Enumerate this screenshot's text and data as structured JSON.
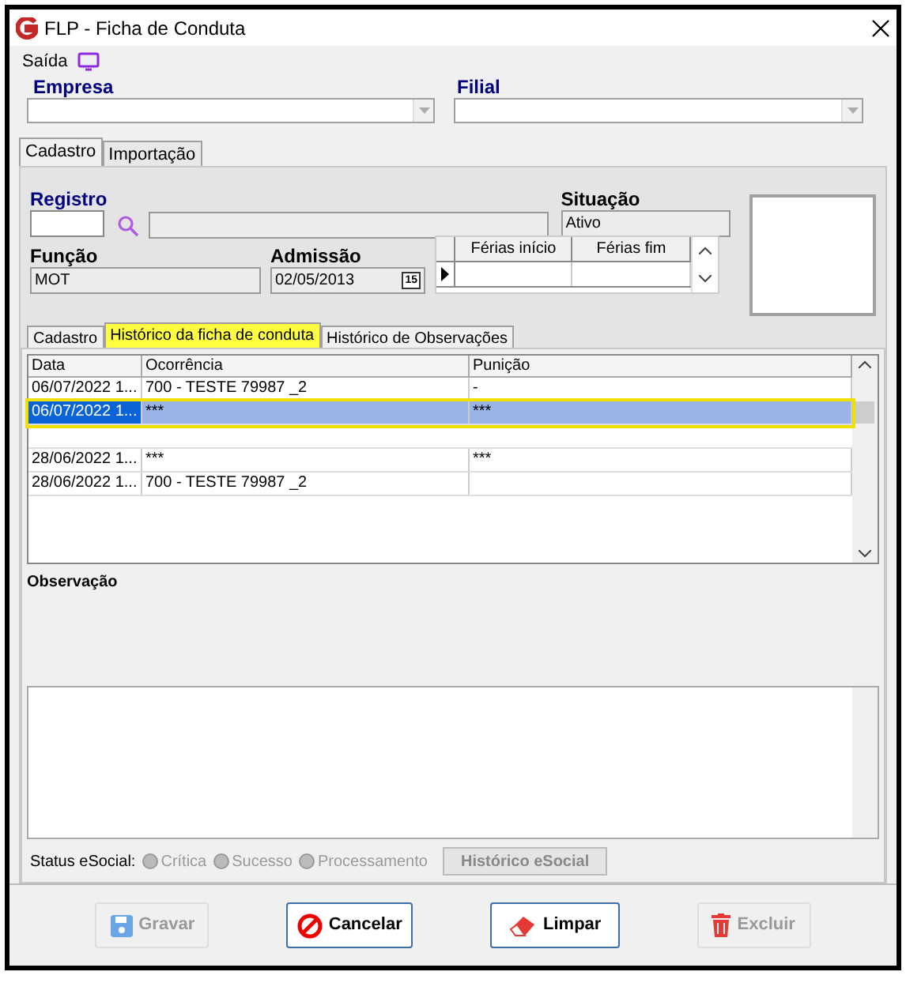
{
  "window": {
    "title": "FLP - Ficha de Conduta"
  },
  "menu": {
    "label": "Saída"
  },
  "empresa": {
    "label": "Empresa"
  },
  "filial": {
    "label": "Filial"
  },
  "top_tabs": [
    {
      "label": "Cadastro",
      "selected": true
    },
    {
      "label": "Importação",
      "selected": false
    }
  ],
  "registro": {
    "label": "Registro"
  },
  "situacao": {
    "label": "Situação",
    "value": "Ativo"
  },
  "funcao": {
    "label": "Função",
    "value": "MOT"
  },
  "admissao": {
    "label": "Admissão",
    "value": "02/05/2013",
    "calendar": "15"
  },
  "ferias": {
    "columns": [
      "Férias início",
      "Férias fim"
    ]
  },
  "inner_tabs": [
    {
      "label": "Cadastro",
      "selected": false,
      "highlighted": false
    },
    {
      "label": "Histórico da ficha de conduta",
      "selected": true,
      "highlighted": true
    },
    {
      "label": "Histórico de Observações",
      "selected": false,
      "highlighted": false
    }
  ],
  "table": {
    "columns": [
      "Data",
      "Ocorrência",
      "Punição"
    ],
    "rows": [
      {
        "cells": [
          "06/07/2022 1...",
          "700 - TESTE 79987 _2",
          "-"
        ],
        "selected": false
      },
      {
        "cells": [
          "06/07/2022 1...",
          "***",
          "***"
        ],
        "selected": true
      },
      {
        "cells": [],
        "selected": false
      },
      {
        "cells": [
          "28/06/2022 1...",
          "***",
          "***"
        ],
        "selected": false
      },
      {
        "cells": [
          "28/06/2022 1...",
          "700 - TESTE 79987 _2",
          ""
        ],
        "selected": false
      }
    ]
  },
  "observacao": {
    "label": "Observação"
  },
  "status": {
    "label": "Status eSocial:",
    "options": [
      {
        "label": "Crítica",
        "selected": false
      },
      {
        "label": "Sucesso",
        "selected": false
      },
      {
        "label": "Processamento",
        "selected": false
      }
    ],
    "history_button": "Histórico eSocial"
  },
  "buttons": [
    {
      "kind": "save",
      "label": "Gravar",
      "disabled": true
    },
    {
      "kind": "cancel",
      "label": "Cancelar",
      "disabled": false
    },
    {
      "kind": "clear",
      "label": "Limpar",
      "disabled": false
    },
    {
      "kind": "delete",
      "label": "Excluir",
      "disabled": true
    }
  ]
}
